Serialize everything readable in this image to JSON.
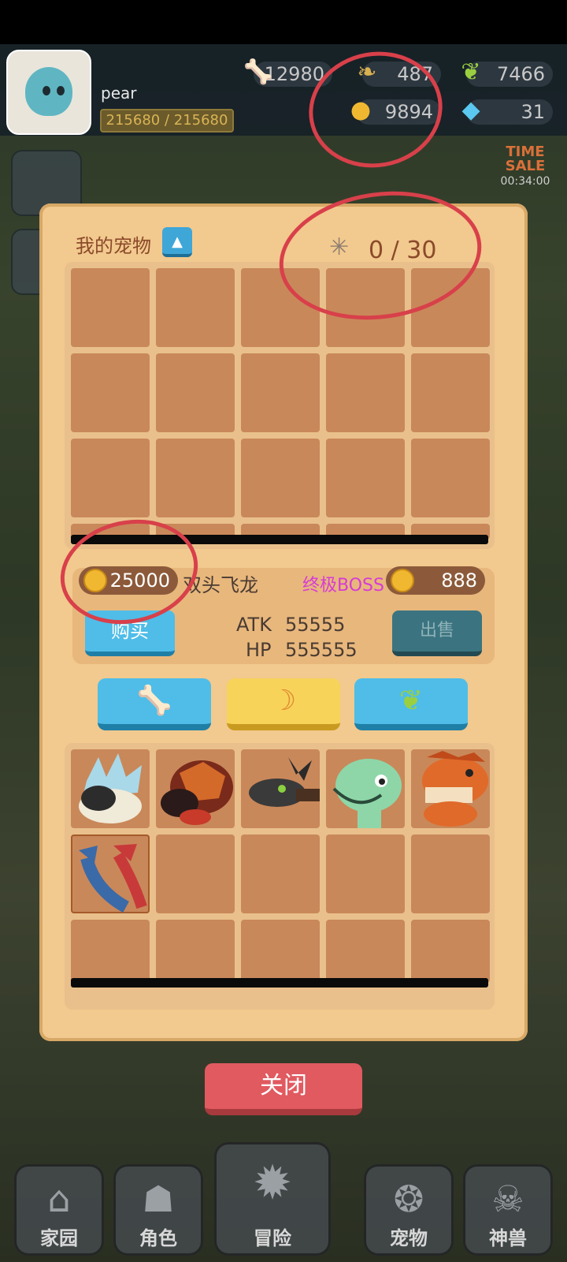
{
  "player": {
    "name": "pear",
    "hp": "215680 / 215680"
  },
  "resources": {
    "bone": "12980",
    "horn": "487",
    "leaf": "7466",
    "coin": "9894",
    "gem": "31"
  },
  "time_sale": "TIME SALE",
  "time_sale_timer": "00:34:00",
  "panel": {
    "title": "我的宠物",
    "capacity": "0 / 30"
  },
  "selected_pet": {
    "buy_price": "25000",
    "name": "双头飞龙",
    "rank": "终极BOSS",
    "sell_price": "888",
    "atk_label": "ATK",
    "atk": "55555",
    "hp_label": "HP",
    "hp": "555555",
    "buy_label": "购买",
    "sell_label": "出售"
  },
  "tabs": [
    {
      "icon": "bone-icon"
    },
    {
      "icon": "horn-icon"
    },
    {
      "icon": "leaf-icon"
    }
  ],
  "monsters": [
    "ice-spike-beast",
    "lava-shell-beast",
    "black-horned-dragon",
    "green-dino",
    "orange-trex",
    "two-headed-dragon"
  ],
  "close_label": "关闭",
  "nav": [
    {
      "label": "家园",
      "icon": "home-icon"
    },
    {
      "label": "角色",
      "icon": "character-icon"
    },
    {
      "label": "冒险",
      "icon": "adventure-icon"
    },
    {
      "label": "宠物",
      "icon": "pet-icon"
    },
    {
      "label": "神兽",
      "icon": "beast-icon"
    }
  ],
  "colors": {
    "panel": "#f2c98e",
    "cell": "#c9885a",
    "rank": "#d63cd6",
    "annotation": "#d8404a"
  }
}
